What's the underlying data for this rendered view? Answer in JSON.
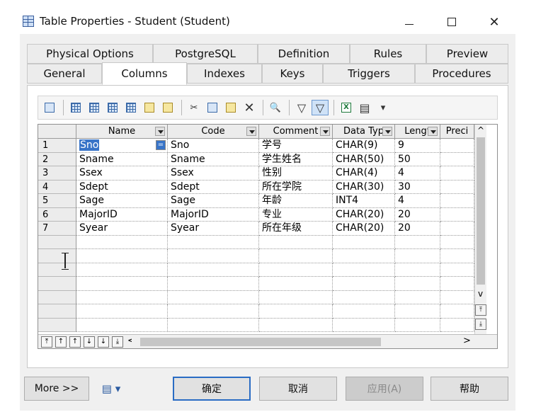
{
  "window": {
    "title": "Table Properties - Student (Student)",
    "controls": [
      "minimize",
      "maximize",
      "close"
    ],
    "close_glyph": "✕"
  },
  "tabs_row1": [
    {
      "label": "Physical Options"
    },
    {
      "label": "PostgreSQL"
    },
    {
      "label": "Definition"
    },
    {
      "label": "Rules"
    },
    {
      "label": "Preview"
    }
  ],
  "tabs_row2": [
    {
      "label": "General"
    },
    {
      "label": "Columns",
      "active": true
    },
    {
      "label": "Indexes"
    },
    {
      "label": "Keys"
    },
    {
      "label": "Triggers"
    },
    {
      "label": "Procedures"
    }
  ],
  "toolbar": {
    "icons": [
      "properties-icon",
      "insert-row-icon",
      "add-row-icon",
      "add-columns-icon",
      "reuse-columns-icon",
      "note-icon",
      "new-icon",
      "cut-icon",
      "copy-icon",
      "paste-icon",
      "delete-icon",
      "find-icon",
      "filter-icon",
      "filter-active-icon",
      "excel-icon",
      "print-icon",
      "dropdown-icon"
    ],
    "cut_glyph": "✂",
    "delete_glyph": "✕",
    "find_glyph": "🔍",
    "filter_glyph": "▽",
    "excel_glyph": "X",
    "print_glyph": "▤",
    "dropdown_glyph": "▾"
  },
  "grid": {
    "columns": [
      "Name",
      "Code",
      "Comment",
      "Data Typ",
      "Lengt",
      "Preci"
    ],
    "rows": [
      {
        "num": "1",
        "name": "Sno",
        "code": "Sno",
        "comment": "学号",
        "type": "CHAR(9)",
        "length": "9"
      },
      {
        "num": "2",
        "name": "Sname",
        "code": "Sname",
        "comment": "学生姓名",
        "type": "CHAR(50)",
        "length": "50"
      },
      {
        "num": "3",
        "name": "Ssex",
        "code": "Ssex",
        "comment": "性别",
        "type": "CHAR(4)",
        "length": "4"
      },
      {
        "num": "4",
        "name": "Sdept",
        "code": "Sdept",
        "comment": "所在学院",
        "type": "CHAR(30)",
        "length": "30"
      },
      {
        "num": "5",
        "name": "Sage",
        "code": "Sage",
        "comment": "年龄",
        "type": "INT4",
        "length": "4"
      },
      {
        "num": "6",
        "name": "MajorID",
        "code": "MajorID",
        "comment": "专业",
        "type": "CHAR(20)",
        "length": "20"
      },
      {
        "num": "7",
        "name": "Syear",
        "code": "Syear",
        "comment": "所在年级",
        "type": "CHAR(20)",
        "length": "20"
      }
    ],
    "selected_cell_button": "=",
    "move_buttons": [
      "⤒",
      "↑",
      "↑",
      "↓",
      "↓",
      "⤓"
    ],
    "scroll_left": "<",
    "scroll_right": ">",
    "scroll_up": "^",
    "scroll_down": "v",
    "page_up": "⤒",
    "page_down": "⤓"
  },
  "footer": {
    "more": "More >>",
    "menu_glyph": "▤ ▾",
    "ok": "确定",
    "cancel": "取消",
    "apply": "应用(A)",
    "help": "帮助"
  }
}
